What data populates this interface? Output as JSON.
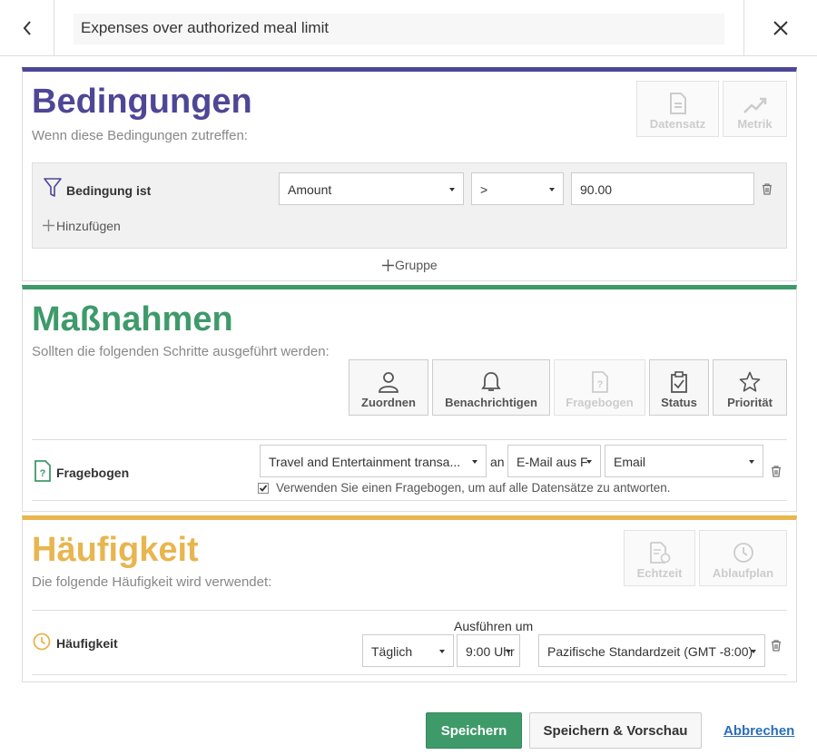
{
  "header": {
    "title": "Expenses over authorized meal limit"
  },
  "conditions": {
    "title": "Bedingungen",
    "subtitle": "Wenn diese Bedingungen zutreffen:",
    "tiles": [
      {
        "label": "Datensatz",
        "icon": "document-icon",
        "enabled": false
      },
      {
        "label": "Metrik",
        "icon": "trend-icon",
        "enabled": false
      }
    ],
    "row_label": "Bedingung ist",
    "field_value": "Amount",
    "operator_value": ">",
    "threshold_value": "90.00",
    "add_label": "Hinzufügen",
    "group_label": "Gruppe"
  },
  "actions": {
    "title": "Maßnahmen",
    "subtitle": "Sollten die folgenden Schritte ausgeführt werden:",
    "tiles": [
      {
        "label": "Zuordnen",
        "icon": "person-icon",
        "enabled": true
      },
      {
        "label": "Benachrichtigen",
        "icon": "bell-icon",
        "enabled": true
      },
      {
        "label": "Fragebogen",
        "icon": "question-doc-icon",
        "enabled": false
      },
      {
        "label": "Status",
        "icon": "clipboard-check-icon",
        "enabled": true
      },
      {
        "label": "Priorität",
        "icon": "star-icon",
        "enabled": true
      }
    ],
    "row_label": "Fragebogen",
    "questionnaire_value": "Travel and Entertainment transa...",
    "connector": "an",
    "recipient_source_value": "E-Mail aus F",
    "recipient_value": "Email",
    "checkbox_label": "Verwenden Sie einen Fragebogen, um auf alle Datensätze zu antworten.",
    "checkbox_checked": true
  },
  "frequency": {
    "title": "Häufigkeit",
    "subtitle": "Die folgende Häufigkeit wird verwendet:",
    "tiles": [
      {
        "label": "Echtzeit",
        "icon": "doc-refresh-icon",
        "enabled": false
      },
      {
        "label": "Ablaufplan",
        "icon": "clock-icon",
        "enabled": false
      }
    ],
    "row_label": "Häufigkeit",
    "run_at_label": "Ausführen um",
    "interval_value": "Täglich",
    "time_value": "9:00 Uhr",
    "timezone_value": "Pazifische Standardzeit (GMT -8:00)"
  },
  "footer": {
    "save_label": "Speichern",
    "save_preview_label": "Speichern & Vorschau",
    "cancel_label": "Abbrechen"
  },
  "colors": {
    "conditions_accent": "#4d4796",
    "actions_accent": "#3f9a6a",
    "frequency_accent": "#e8b54f",
    "link": "#2a6ebb"
  }
}
